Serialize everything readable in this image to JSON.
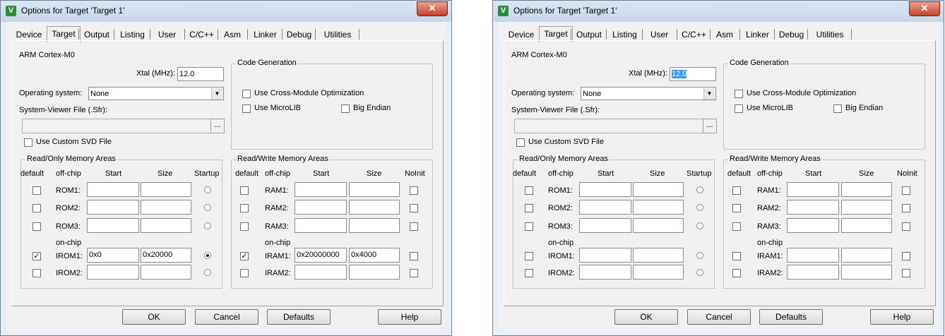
{
  "dialogs": [
    {
      "title": "Options for Target 'Target 1'",
      "tabs": [
        "Device",
        "Target",
        "Output",
        "Listing",
        "User",
        "C/C++",
        "Asm",
        "Linker",
        "Debug",
        "Utilities"
      ],
      "device_name": "ARM Cortex-M0",
      "xtal_label": "Xtal (MHz):",
      "xtal_value": "12.0",
      "xtal_selected": false,
      "os_label": "Operating system:",
      "os_value": "None",
      "svf_label": "System-Viewer File (.Sfr):",
      "browse_label": "...",
      "custom_svd_label": "Use Custom SVD File",
      "codegen_title": "Code Generation",
      "cross_module_label": "Use Cross-Module Optimization",
      "microlib_label": "Use MicroLIB",
      "big_endian_label": "Big Endian",
      "ro_title": "Read/Only Memory Areas",
      "ro_headers": [
        "default",
        "off-chip",
        "Start",
        "Size",
        "Startup"
      ],
      "ro_rows": [
        {
          "name": "ROM1:",
          "default": false,
          "start": "",
          "size": "",
          "startup": false
        },
        {
          "name": "ROM2:",
          "default": false,
          "start": "",
          "size": "",
          "startup": false
        },
        {
          "name": "ROM3:",
          "default": false,
          "start": "",
          "size": "",
          "startup": false
        },
        {
          "name": "IROM1:",
          "default": true,
          "start": "0x0",
          "size": "0x20000",
          "startup": true
        },
        {
          "name": "IROM2:",
          "default": false,
          "start": "",
          "size": "",
          "startup": false
        }
      ],
      "rw_title": "Read/Write Memory Areas",
      "rw_headers": [
        "default",
        "off-chip",
        "Start",
        "Size",
        "NoInit"
      ],
      "rw_rows": [
        {
          "name": "RAM1:",
          "default": false,
          "start": "",
          "size": "",
          "noinit": false
        },
        {
          "name": "RAM2:",
          "default": false,
          "start": "",
          "size": "",
          "noinit": false
        },
        {
          "name": "RAM3:",
          "default": false,
          "start": "",
          "size": "",
          "noinit": false
        },
        {
          "name": "IRAM1:",
          "default": true,
          "start": "0x20000000",
          "size": "0x4000",
          "noinit": false
        },
        {
          "name": "IRAM2:",
          "default": false,
          "start": "",
          "size": "",
          "noinit": false
        }
      ],
      "onchip_label": "on-chip",
      "buttons": {
        "ok": "OK",
        "cancel": "Cancel",
        "defaults": "Defaults",
        "help": "Help"
      }
    },
    {
      "title": "Options for Target 'Target 1'",
      "tabs": [
        "Device",
        "Target",
        "Output",
        "Listing",
        "User",
        "C/C++",
        "Asm",
        "Linker",
        "Debug",
        "Utilities"
      ],
      "device_name": "ARM Cortex-M0",
      "xtal_label": "Xtal (MHz):",
      "xtal_value": "12.0",
      "xtal_selected": true,
      "os_label": "Operating system:",
      "os_value": "None",
      "svf_label": "System-Viewer File (.Sfr):",
      "browse_label": "...",
      "custom_svd_label": "Use Custom SVD File",
      "codegen_title": "Code Generation",
      "cross_module_label": "Use Cross-Module Optimization",
      "microlib_label": "Use MicroLIB",
      "big_endian_label": "Big Endian",
      "ro_title": "Read/Only Memory Areas",
      "ro_headers": [
        "default",
        "off-chip",
        "Start",
        "Size",
        "Startup"
      ],
      "ro_rows": [
        {
          "name": "ROM1:",
          "default": false,
          "start": "",
          "size": "",
          "startup": false
        },
        {
          "name": "ROM2:",
          "default": false,
          "start": "",
          "size": "",
          "startup": false
        },
        {
          "name": "ROM3:",
          "default": false,
          "start": "",
          "size": "",
          "startup": false
        },
        {
          "name": "IROM1:",
          "default": false,
          "start": "",
          "size": "",
          "startup": false
        },
        {
          "name": "IROM2:",
          "default": false,
          "start": "",
          "size": "",
          "startup": false
        }
      ],
      "rw_title": "Read/Write Memory Areas",
      "rw_headers": [
        "default",
        "off-chip",
        "Start",
        "Size",
        "NoInit"
      ],
      "rw_rows": [
        {
          "name": "RAM1:",
          "default": false,
          "start": "",
          "size": "",
          "noinit": false
        },
        {
          "name": "RAM2:",
          "default": false,
          "start": "",
          "size": "",
          "noinit": false
        },
        {
          "name": "RAM3:",
          "default": false,
          "start": "",
          "size": "",
          "noinit": false
        },
        {
          "name": "IRAM1:",
          "default": false,
          "start": "",
          "size": "",
          "noinit": false
        },
        {
          "name": "IRAM2:",
          "default": false,
          "start": "",
          "size": "",
          "noinit": false
        }
      ],
      "onchip_label": "on-chip",
      "buttons": {
        "ok": "OK",
        "cancel": "Cancel",
        "defaults": "Defaults",
        "help": "Help"
      }
    }
  ]
}
